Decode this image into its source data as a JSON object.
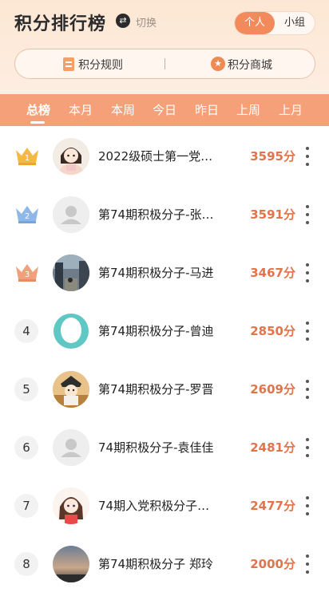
{
  "header": {
    "title": "积分排行榜",
    "switch_label": "切换",
    "segments": [
      {
        "label": "个人",
        "active": true
      },
      {
        "label": "小组",
        "active": false
      }
    ],
    "actions": {
      "rules": "积分规则",
      "mall": "积分商城"
    }
  },
  "tabs": [
    {
      "label": "总榜",
      "active": true
    },
    {
      "label": "本月",
      "active": false
    },
    {
      "label": "本周",
      "active": false
    },
    {
      "label": "今日",
      "active": false
    },
    {
      "label": "昨日",
      "active": false
    },
    {
      "label": "上周",
      "active": false
    },
    {
      "label": "上月",
      "active": false
    }
  ],
  "colors": {
    "accent": "#f38a5b",
    "tab_bar": "#f6a07a",
    "score": "#e2734a",
    "gold": "#f5b841",
    "silver": "#8fb7e8",
    "bronze": "#f0a07a"
  },
  "ranking": [
    {
      "rank": "1",
      "name": "2022级硕士第一党…",
      "score": "3595分",
      "avatar": "cartoon-girl-avatar"
    },
    {
      "rank": "2",
      "name": "第74期积极分子-张…",
      "score": "3591分",
      "avatar": "default-user-avatar"
    },
    {
      "rank": "3",
      "name": "第74期积极分子-马进",
      "score": "3467分",
      "avatar": "street-photo-avatar"
    },
    {
      "rank": "4",
      "name": "第74期积极分子-曾迪",
      "score": "2850分",
      "avatar": "teal-blank-avatar"
    },
    {
      "rank": "5",
      "name": "第74期积极分子-罗晋",
      "score": "2609分",
      "avatar": "cartoon-character-avatar"
    },
    {
      "rank": "6",
      "name": "74期积极分子-袁佳佳",
      "score": "2481分",
      "avatar": "default-user-avatar"
    },
    {
      "rank": "7",
      "name": "74期入党积极分子…",
      "score": "2477分",
      "avatar": "anime-girl-avatar"
    },
    {
      "rank": "8",
      "name": "第74期积极分子 郑玲",
      "score": "2000分",
      "avatar": "sunset-sky-avatar"
    }
  ]
}
